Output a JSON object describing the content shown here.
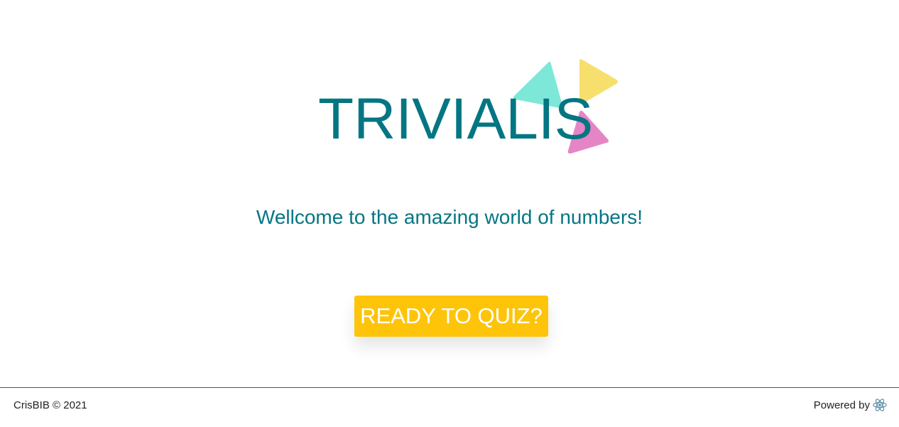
{
  "app": {
    "title": "TRIVIALIS",
    "tagline": "Wellcome to the amazing world of numbers!",
    "cta_label": "READY TO QUIZ?"
  },
  "footer": {
    "copyright": "CrisBIB © 2021",
    "powered_by": "Powered by",
    "powered_icon": "react-icon"
  },
  "colors": {
    "brand": "#047683",
    "accent": "#fdc40a",
    "triangle_teal": "#7ee8d8",
    "triangle_yellow": "#f7df6e",
    "triangle_pink": "#e585c6"
  }
}
